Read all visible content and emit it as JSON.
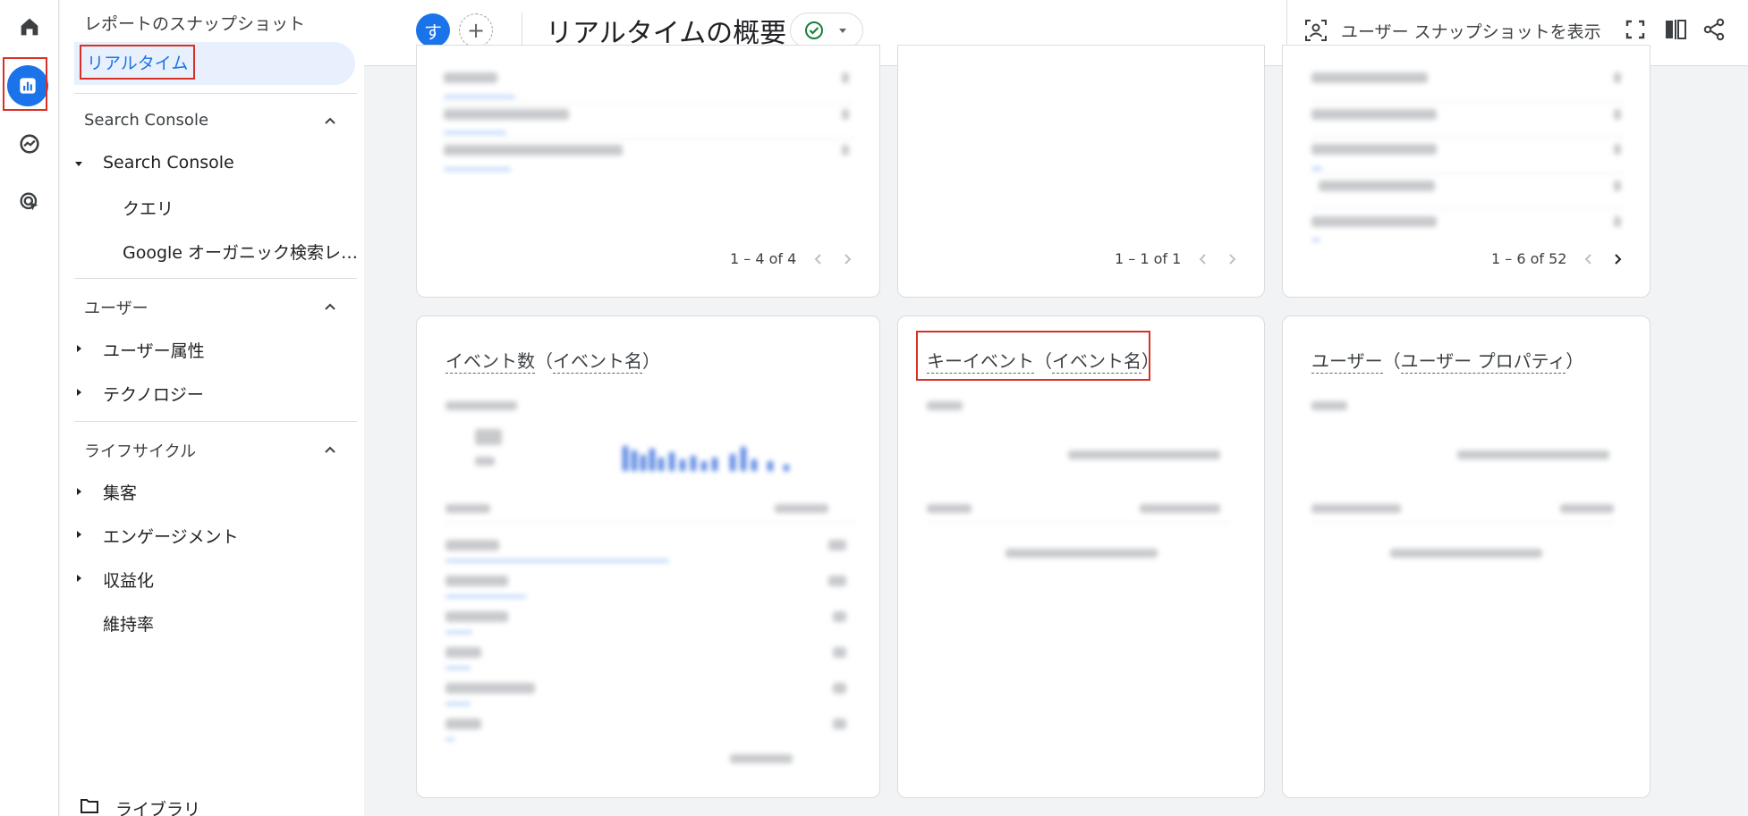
{
  "sidebar": {
    "top_label": "レポートのスナップショット",
    "active_label": "リアルタイム",
    "sections": {
      "search_console": {
        "header": "Search Console",
        "group": "Search Console",
        "items": [
          "クエリ",
          "Google オーガニック検索レポート"
        ]
      },
      "user": {
        "header": "ユーザー",
        "items": [
          "ユーザー属性",
          "テクノロジー"
        ]
      },
      "lifecycle": {
        "header": "ライフサイクル",
        "items": [
          "集客",
          "エンゲージメント",
          "収益化",
          "維持率"
        ]
      }
    },
    "library_label": "ライブラリ"
  },
  "rail": {
    "icons": [
      "home-icon",
      "reports-icon",
      "explore-icon",
      "advertising-icon"
    ]
  },
  "header": {
    "avatar_letter": "す",
    "add_label": "+",
    "title": "リアルタイムの概要",
    "snapshot_label": "ユーザー スナップショットを表示"
  },
  "cards": {
    "top_left_pager": "1 – 4 of 4",
    "top_mid_pager": "1 – 1 of 1",
    "top_right_pager": "1 – 6 of 52",
    "event_count": {
      "title_a": "イベント数",
      "title_b": "イベント名"
    },
    "key_event": {
      "title_a": "キーイベント",
      "title_b": "イベント名"
    },
    "user_prop": {
      "title_a": "ユーザー",
      "title_b": "ユーザー プロパティ"
    }
  },
  "colors": {
    "accent": "#1a73e8",
    "highlight_box": "#d93025",
    "success": "#188038"
  }
}
